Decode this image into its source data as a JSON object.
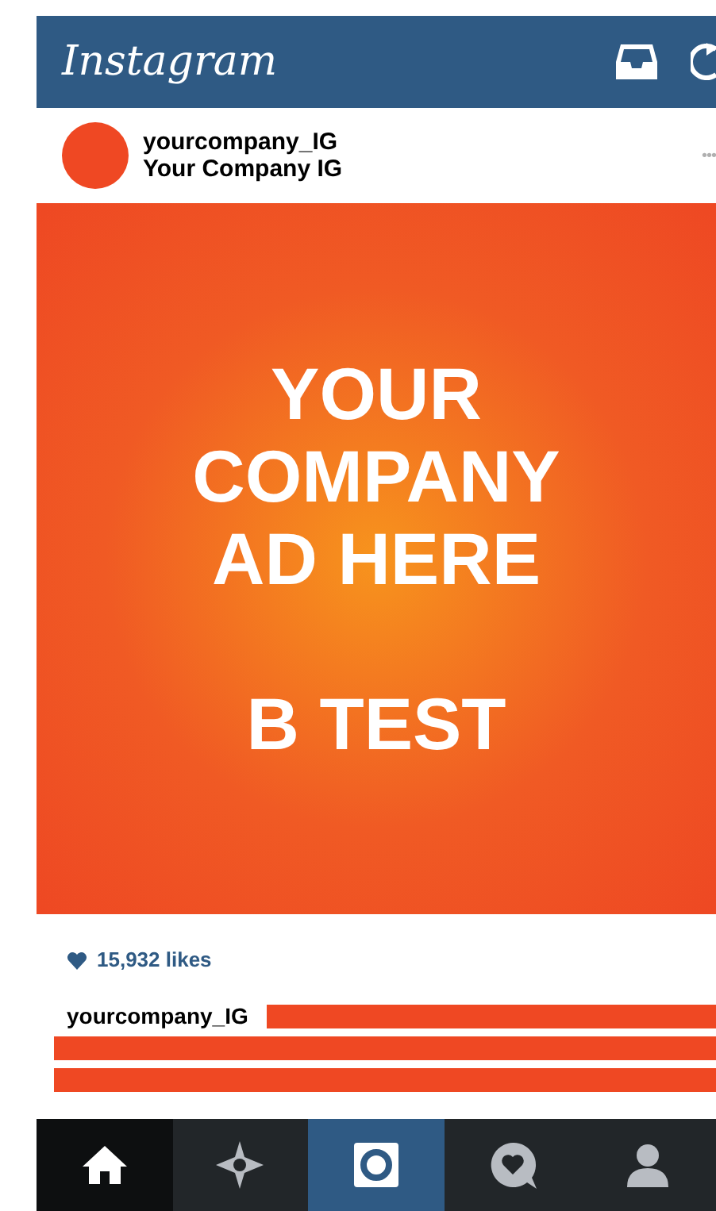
{
  "header": {
    "logo": "Instagram"
  },
  "post": {
    "username": "yourcompany_IG",
    "display_name": "Your Company IG",
    "more": "•••",
    "ad": {
      "headline": [
        "YOUR",
        "COMPANY",
        "AD HERE"
      ],
      "subline": "B TEST"
    },
    "likes": "15,932 likes",
    "caption_user": "yourcompany_IG"
  },
  "nav": [
    {
      "kind": "home",
      "selected": true
    },
    {
      "kind": "explore",
      "selected": false
    },
    {
      "kind": "camera",
      "selected": false
    },
    {
      "kind": "activity",
      "selected": false
    },
    {
      "kind": "profile",
      "selected": false
    }
  ]
}
